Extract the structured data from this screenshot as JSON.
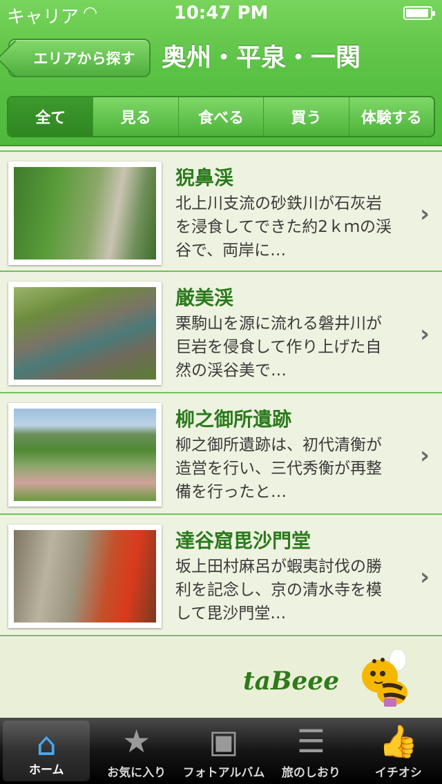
{
  "status": {
    "carrier": "キャリア",
    "time": "10:47 PM"
  },
  "nav": {
    "back_label": "エリアから探す",
    "title": "奥州・平泉・一関"
  },
  "segments": [
    "全て",
    "見る",
    "食べる",
    "買う",
    "体験する"
  ],
  "active_segment": "全て",
  "items": [
    {
      "title": "猊鼻渓",
      "desc": "北上川支流の砂鉄川が石灰岩を浸食してできた約2ｋｍの渓谷で、両岸に…"
    },
    {
      "title": "厳美渓",
      "desc": "栗駒山を源に流れる磐井川が巨岩を侵食して作り上げた自然の渓谷美で…"
    },
    {
      "title": "柳之御所遺跡",
      "desc": "柳之御所遺跡は、初代清衡が造営を行い、三代秀衡が再整備を行ったと…"
    },
    {
      "title": "達谷窟毘沙門堂",
      "desc": "坂上田村麻呂が蝦夷討伐の勝利を記念し、京の清水寺を模して毘沙門堂…"
    }
  ],
  "brand": "taBeee",
  "tabs": [
    {
      "label": "ホーム",
      "icon": "home-icon"
    },
    {
      "label": "お気に入り",
      "icon": "star-icon"
    },
    {
      "label": "フォトアルバム",
      "icon": "photo-album-icon"
    },
    {
      "label": "旅のしおり",
      "icon": "clipboard-icon"
    },
    {
      "label": "イチオシ",
      "icon": "thumbs-up-icon"
    }
  ],
  "active_tab": "ホーム",
  "colors": {
    "header_green": "#5cc346",
    "title_green": "#2a7a1c",
    "tab_active": "#4aa8f0"
  }
}
